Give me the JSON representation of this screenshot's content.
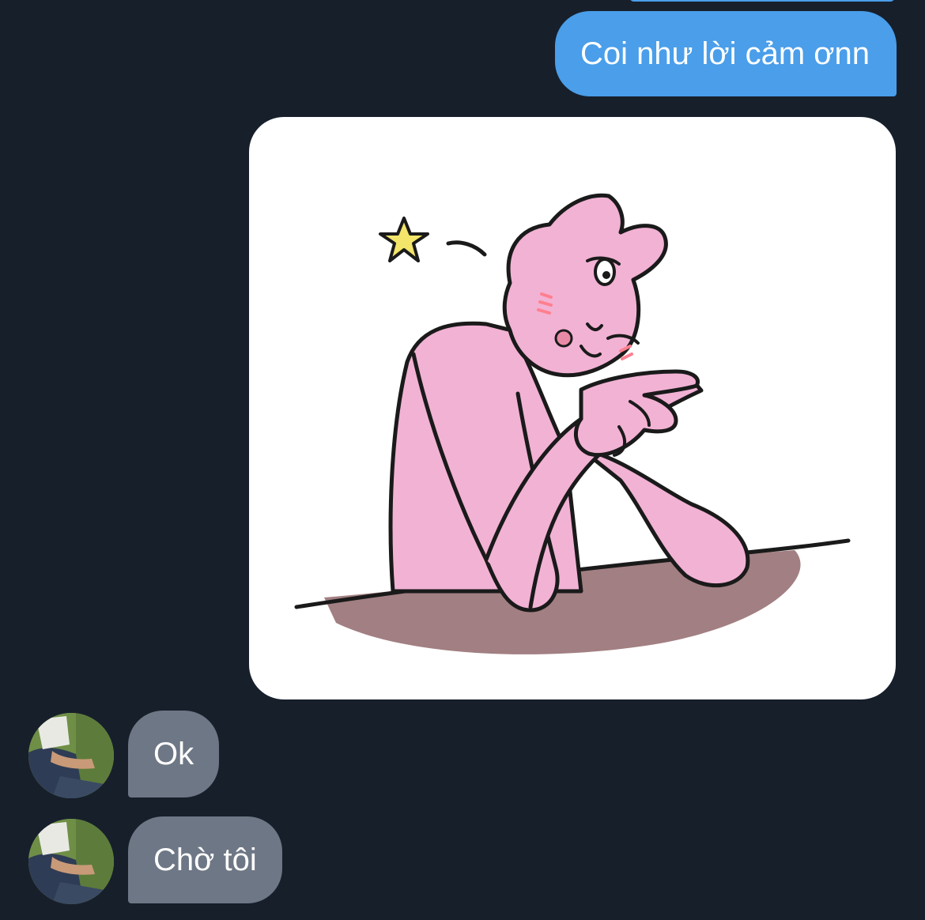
{
  "colors": {
    "background": "#171f2b",
    "sent_bubble": "#4a9eea",
    "received_bubble": "#6e7785",
    "text": "#ffffff"
  },
  "messages": {
    "sent": [
      {
        "text": "Coi như lời cảm ơnn"
      }
    ],
    "sticker": {
      "description_icon": "pink-bunny-sticker-icon"
    },
    "received": [
      {
        "text": "Ok",
        "avatar_icon": "user-avatar"
      },
      {
        "text": "Chờ tôi",
        "avatar_icon": "user-avatar"
      }
    ]
  }
}
